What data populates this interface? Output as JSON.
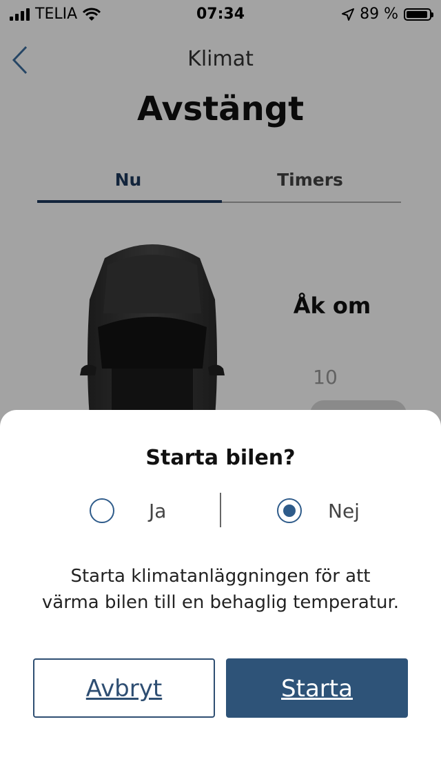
{
  "status_bar": {
    "carrier": "TELIA",
    "time": "07:34",
    "battery_percent": "89 %",
    "icons": [
      "signal-icon",
      "wifi-icon",
      "location-icon",
      "battery-icon"
    ]
  },
  "header": {
    "back_icon": "chevron-left-icon",
    "title": "Klimat",
    "status": "Avstängt"
  },
  "tabs": [
    {
      "label": "Nu",
      "active": true
    },
    {
      "label": "Timers",
      "active": false
    }
  ],
  "main": {
    "car_image": "car-top-view",
    "departure_label": "Åk om",
    "departure_value": "10"
  },
  "dialog": {
    "title": "Starta bilen?",
    "options": [
      {
        "label": "Ja",
        "selected": false
      },
      {
        "label": "Nej",
        "selected": true
      }
    ],
    "description_line1": "Starta klimatanläggningen för att",
    "description_line2": "värma bilen till en behaglig temperatur.",
    "cancel_label": "Avbryt",
    "start_label": "Starta"
  },
  "colors": {
    "accent": "#2e5378",
    "radio": "#2e5b8a",
    "overlay": "rgba(0,0,0,0.36)"
  }
}
